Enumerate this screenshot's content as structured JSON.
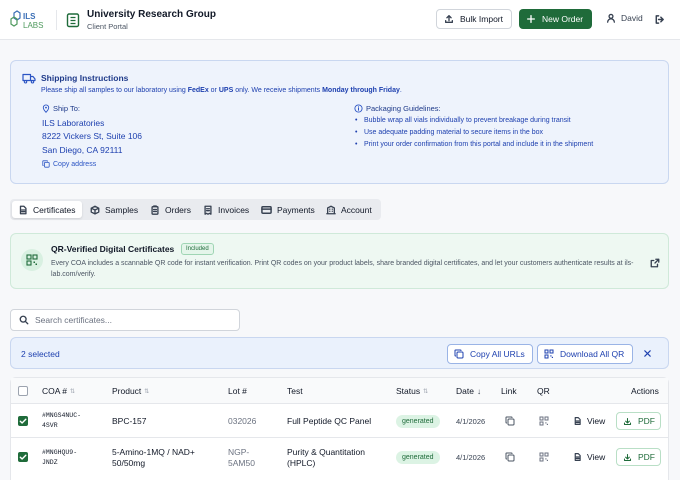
{
  "header": {
    "logo_text": "ILS LABS",
    "org_name": "University Research Group",
    "org_subtitle": "Client Portal",
    "bulk_import_label": "Bulk Import",
    "new_order_label": "New Order",
    "user_name": "David"
  },
  "shipping": {
    "title": "Shipping Instructions",
    "desc_pre": "Please ship all samples to our laboratory using ",
    "desc_fedex": "FedEx",
    "desc_or": " or ",
    "desc_ups": "UPS",
    "desc_mid": " only. We receive shipments ",
    "desc_days": "Monday through Friday",
    "desc_end": ".",
    "ship_to_label": "Ship To:",
    "address": [
      "ILS Laboratories",
      "8222 Vickers St, Suite 106",
      "San Diego, CA 92111"
    ],
    "copy_label": "Copy address",
    "packaging_label": "Packaging Guidelines:",
    "packaging": [
      "Bubble wrap all vials individually to prevent breakage during transit",
      "Use adequate padding material to secure items in the box",
      "Print your order confirmation from this portal and include it in the shipment"
    ]
  },
  "tabs": [
    {
      "label": "Certificates",
      "icon": "document-icon",
      "active": true
    },
    {
      "label": "Samples",
      "icon": "box-icon"
    },
    {
      "label": "Orders",
      "icon": "clipboard-icon"
    },
    {
      "label": "Invoices",
      "icon": "receipt-icon"
    },
    {
      "label": "Payments",
      "icon": "credit-card-icon"
    },
    {
      "label": "Account",
      "icon": "building-icon"
    }
  ],
  "qr_banner": {
    "title": "QR-Verified Digital Certificates",
    "badge": "Included",
    "description": "Every COA includes a scannable QR code for instant verification. Print QR codes on your product labels, share branded digital certificates, and let your customers authenticate results at ils-lab.com/verify."
  },
  "search": {
    "placeholder": "Search certificates..."
  },
  "selection": {
    "count_label": "2 selected",
    "copy_urls_label": "Copy All URLs",
    "download_qr_label": "Download All QR"
  },
  "table": {
    "columns": {
      "coa": "COA #",
      "product": "Product",
      "lot": "Lot #",
      "test": "Test",
      "status": "Status",
      "date": "Date",
      "link": "Link",
      "qr": "QR",
      "actions": "Actions"
    },
    "rows": [
      {
        "coa": [
          "#MNGS4NUC-",
          "4SVR"
        ],
        "product": [
          "BPC-157"
        ],
        "lot": [
          "032026"
        ],
        "test": [
          "Full Peptide QC Panel"
        ],
        "status": "generated",
        "date": "4/1/2026",
        "view_label": "View",
        "pdf_label": "PDF",
        "checked": true
      },
      {
        "coa": [
          "#MNGHQU9-",
          "JNDZ"
        ],
        "product": [
          "5-Amino-1MQ / NAD+",
          "50/50mg"
        ],
        "lot": [
          "NGP-",
          "5AM50"
        ],
        "test": [
          "Purity & Quantitation",
          "(HPLC)"
        ],
        "status": "generated",
        "date": "4/1/2026",
        "view_label": "View",
        "pdf_label": "PDF",
        "checked": true
      }
    ]
  },
  "colors": {
    "brand_green": "#1f6b3a",
    "info_blue": "#1e40af",
    "qr_bg": "#eef8f2",
    "ship_bg": "#eef3fc"
  }
}
